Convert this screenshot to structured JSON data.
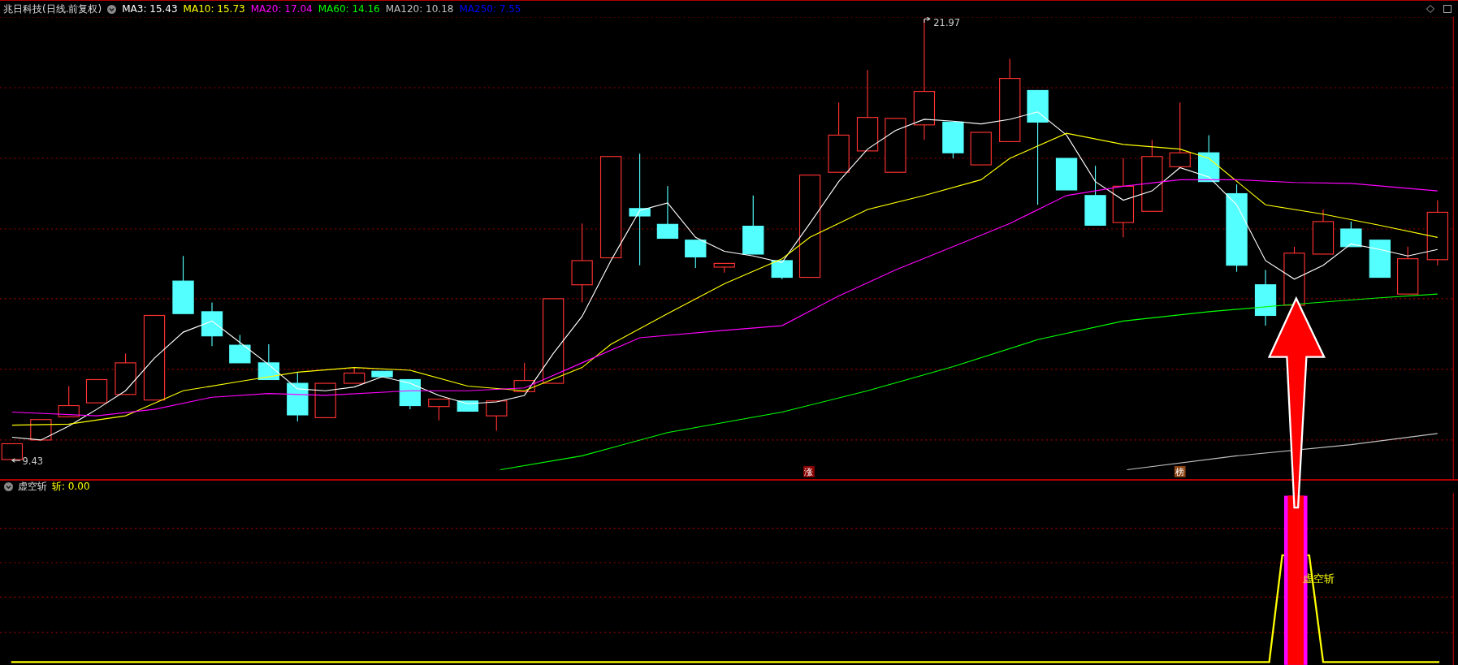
{
  "title": "兆日科技(日线.前复权)",
  "moving_averages": [
    {
      "label": "MA3: 15.43",
      "color": "#ffffff"
    },
    {
      "label": "MA10: 15.73",
      "color": "#ffff00"
    },
    {
      "label": "MA20: 17.04",
      "color": "#ff00ff"
    },
    {
      "label": "MA60: 14.16",
      "color": "#00ff00"
    },
    {
      "label": "MA120: 10.18",
      "color": "#c0c0c0"
    },
    {
      "label": "MA250: 7.55",
      "color": "#0000ff"
    }
  ],
  "price_labels": {
    "high": "21.97",
    "low": "9.43"
  },
  "markers": [
    {
      "text": "涨",
      "color": "#8b0000"
    },
    {
      "text": "榜",
      "color": "#8b4513"
    }
  ],
  "indicator": {
    "name": "虚空斩",
    "value": "斩: 0.00",
    "signal_label": "虚空斩"
  }
}
